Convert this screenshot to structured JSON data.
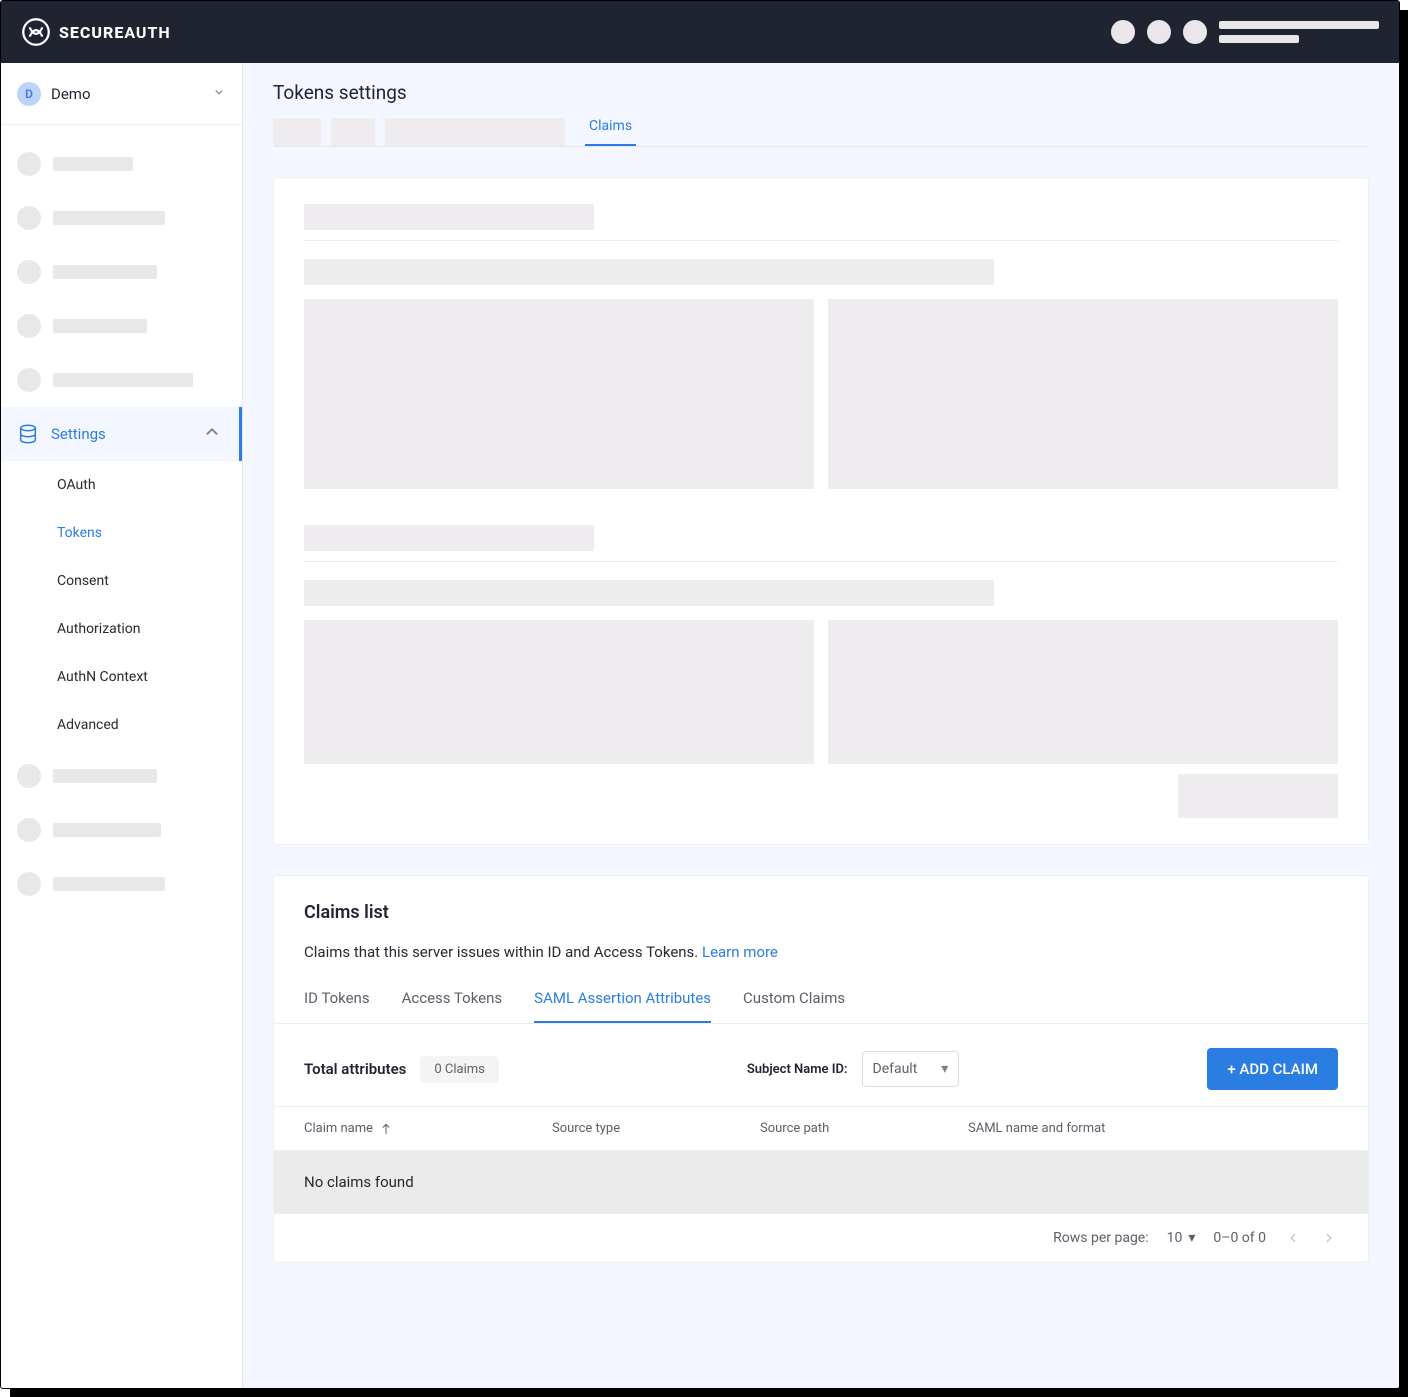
{
  "brand": {
    "prefix": "SECURE",
    "suffix": "AUTH"
  },
  "workspace": {
    "initial": "D",
    "name": "Demo"
  },
  "sidebar": {
    "settings_label": "Settings",
    "sub_items": {
      "oauth": "OAuth",
      "tokens": "Tokens",
      "consent": "Consent",
      "authorization": "Authorization",
      "authn_context": "AuthN Context",
      "advanced": "Advanced"
    }
  },
  "page": {
    "title": "Tokens settings",
    "tabs": {
      "claims": "Claims"
    }
  },
  "claims": {
    "section_title": "Claims list",
    "description": "Claims that this server issues within ID and Access Tokens. ",
    "learn_more": "Learn more",
    "tabs": {
      "id_tokens": "ID Tokens",
      "access_tokens": "Access Tokens",
      "saml": "SAML Assertion Attributes",
      "custom": "Custom Claims"
    },
    "total_label": "Total attributes",
    "total_badge": "0 Claims",
    "subject_name_id_label": "Subject Name ID:",
    "subject_name_id_value": "Default",
    "add_claim_btn": "+ ADD CLAIM",
    "table": {
      "col_name": "Claim name",
      "col_type": "Source type",
      "col_path": "Source path",
      "col_saml": "SAML name and format",
      "empty": "No claims found"
    },
    "footer": {
      "rows_label": "Rows per page:",
      "rows_value": "10",
      "range": "0–0 of 0"
    }
  }
}
